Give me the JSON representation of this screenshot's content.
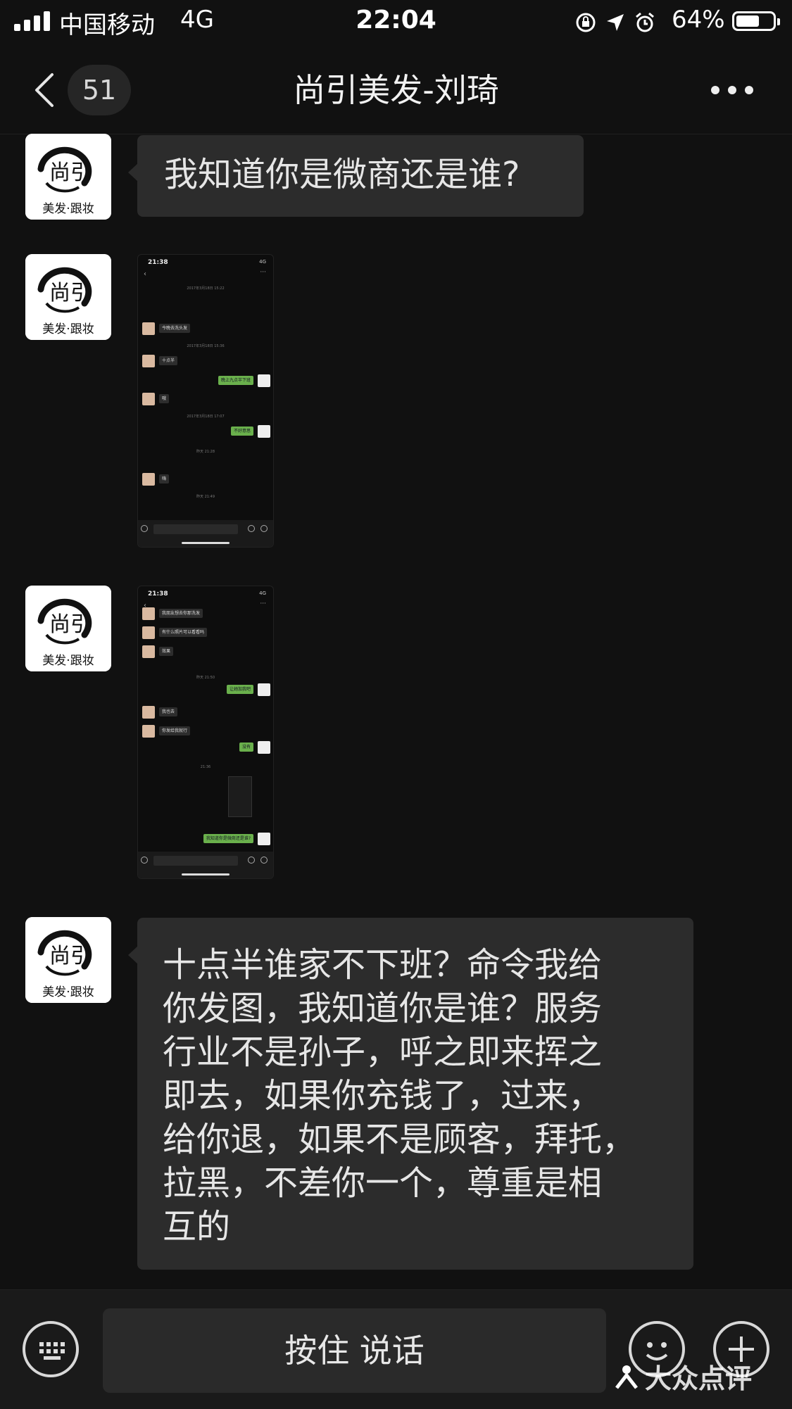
{
  "status_bar": {
    "carrier": "中国移动",
    "network": "4G",
    "time": "22:04",
    "battery_percent": "64%",
    "battery_level": 0.64,
    "icons": [
      "orientation-lock-icon",
      "location-arrow-icon",
      "alarm-icon"
    ]
  },
  "nav": {
    "unread_count": "51",
    "title": "尚引美发-刘琦",
    "more_icon": "more-dots-icon"
  },
  "avatar": {
    "logo_text_top": "尚引",
    "logo_text_bottom": "美发·跟妆"
  },
  "messages": {
    "m1": "我知道你是微商还是谁?",
    "m4": "十点半谁家不下班？命令我给\n你发图，我知道你是谁？服务\n行业不是孙子，呼之即来挥之\n即去，如果你充钱了，过来，\n给你退，如果不是顾客，拜托，\n拉黑，不差你一个，尊重是相\n互的"
  },
  "thumb1": {
    "time": "21:38",
    "net": "4G",
    "msgs": {
      "a": "今晚去洗头发",
      "b": "十点半",
      "c": "晚上九点半下班",
      "d": "哦",
      "e": "不好意思",
      "f": "嗨"
    },
    "sys": {
      "s1": "2017年3月18日 15:22",
      "s2": "2017年3月18日 15:36",
      "s3": "2017年3月18日 17:07",
      "s4": "昨天 21:28",
      "s5": "昨天 21:49"
    }
  },
  "thumb2": {
    "time": "21:38",
    "net": "4G",
    "msgs": {
      "a": "我朋友想去你那洗发",
      "b": "有什么照片可以看看吗",
      "c": "效果",
      "d": "让她加我吧",
      "e": "我也去",
      "f": "你发给我就行",
      "g": "没有",
      "h": "我知道你是微商还是谁?"
    },
    "sys": {
      "s1": "昨天 21:50",
      "s2": "21:36"
    }
  },
  "bottom": {
    "hold_to_talk": "按住 说话",
    "watermark": "大众点评"
  }
}
